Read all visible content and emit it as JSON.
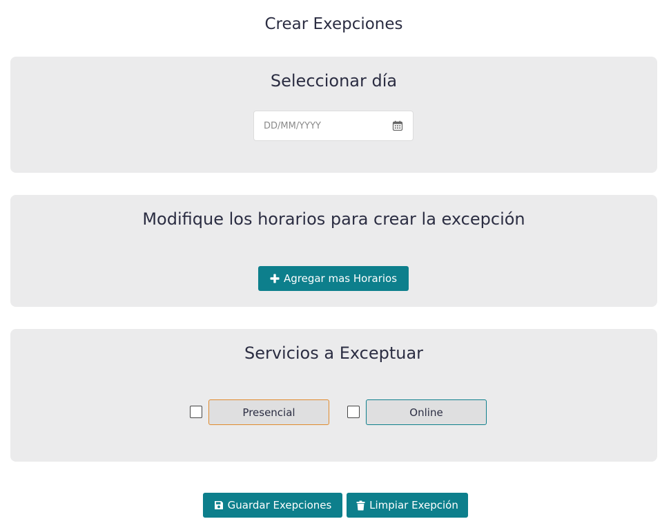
{
  "page": {
    "title": "Crear Exepciones"
  },
  "date_card": {
    "title": "Seleccionar día",
    "date_input": {
      "value": "",
      "placeholder": "DD/MM/YYYY"
    },
    "icon": "calendar-icon"
  },
  "hours_card": {
    "title": "Modifique los horarios para crear la excepción",
    "add_button_label": "Agregar mas Horarios",
    "add_icon": "plus-icon"
  },
  "services_card": {
    "title": "Servicios a Exceptuar",
    "services": [
      {
        "label": "Presencial",
        "checked": false,
        "border_color": "#e08a2c"
      },
      {
        "label": "Online",
        "checked": false,
        "border_color": "#0d7f8c"
      }
    ]
  },
  "actions": {
    "save_label": "Guardar Exepciones",
    "save_icon": "floppy-disk-icon",
    "clear_label": "Limpiar Exepción",
    "clear_icon": "trash-icon"
  },
  "colors": {
    "primary": "#0d7f8c",
    "card_background": "#ebebec",
    "text": "#2b2d42"
  }
}
